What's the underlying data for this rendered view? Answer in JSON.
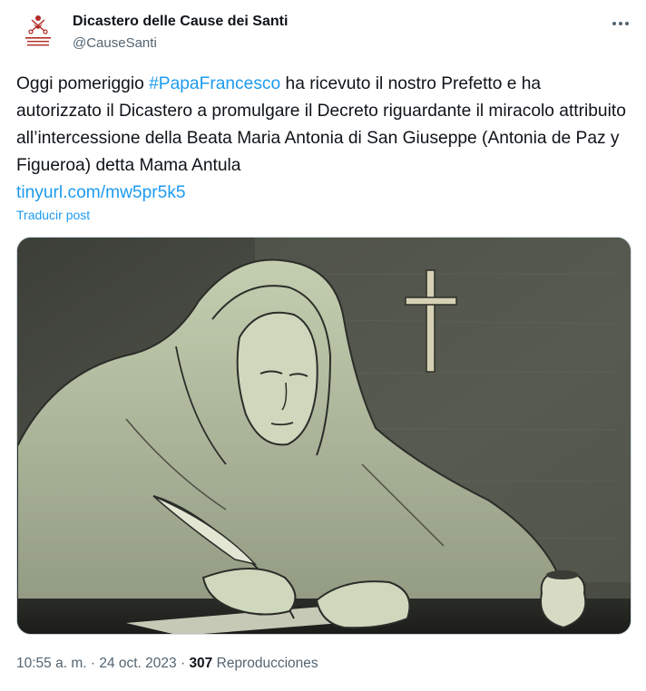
{
  "author": {
    "display_name": "Dicastero delle Cause dei Santi",
    "handle": "@CauseSanti",
    "avatar_caption": "DICASTERIUM DE CAUSIS SANCTORUM",
    "avatar_color": "#b32a25"
  },
  "tweet": {
    "text_before": "Oggi pomeriggio ",
    "hashtag": "#PapaFrancesco",
    "text_after": " ha ricevuto il nostro Prefetto e ha autorizzato il Dicastero a promulgare il Decreto riguardante il miracolo attribuito all’intercessione della Beata Maria Antonia di San Giuseppe (Antonia de Paz y Figueroa) detta Mama Antula",
    "link": "tinyurl.com/mw5pr5k5",
    "translate_label": "Traducir post"
  },
  "media": {
    "alt_icon": "nun-writing-illustration",
    "palette": {
      "wall": "#4d5047",
      "figure": "#b9c4a6",
      "shadow": "#2b2d29"
    }
  },
  "meta": {
    "time": "10:55 a. m.",
    "separator": " · ",
    "date": "24 oct. 2023",
    "views_count": "307",
    "views_label": "Reproducciones"
  },
  "colors": {
    "accent": "#1d9bf0",
    "secondary_text": "#536471",
    "primary_text": "#0f1419"
  }
}
